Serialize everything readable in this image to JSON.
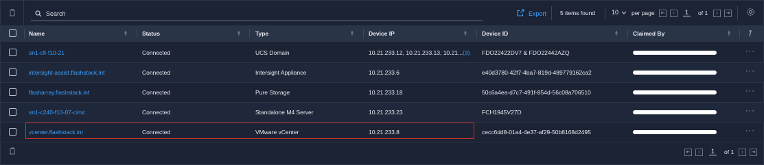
{
  "toolbar": {
    "search_label": "Search",
    "export_label": "Export",
    "items_found": "5 items found",
    "per_page_value": "10",
    "per_page_label": "per page",
    "page_current": "1",
    "page_of": "of 1"
  },
  "table": {
    "columns": [
      "Name",
      "Status",
      "Type",
      "Device IP",
      "Device ID",
      "Claimed By"
    ],
    "rows": [
      {
        "name": "sn1-cfi-f10-21",
        "status": "Connected",
        "type": "UCS Domain",
        "ip": "10.21.233.12, 10.21.233.13, 10.21...",
        "ip_more": "(3)",
        "device_id": "FDO22422DV7 & FDO22442AZQ"
      },
      {
        "name": "intersight-assist.flashstack.int",
        "status": "Connected",
        "type": "Intersight Appliance",
        "ip": "10.21.233.6",
        "ip_more": "",
        "device_id": "e40d3780-42f7-4ba7-819d-489779162ca2"
      },
      {
        "name": "flasharray.flashstack.int",
        "status": "Connected",
        "type": "Pure Storage",
        "ip": "10.21.233.18",
        "ip_more": "",
        "device_id": "50c6a4ea-d7c7-491f-854d-56c08a706510"
      },
      {
        "name": "sn1-c240-f10-07-cimc",
        "status": "Connected",
        "type": "Standalone M4 Server",
        "ip": "10.21.233.23",
        "ip_more": "",
        "device_id": "FCH1945V27D"
      },
      {
        "name": "vcenter.flashstack.int",
        "status": "Connected",
        "type": "VMware vCenter",
        "ip": "10.21.233.8",
        "ip_more": "",
        "device_id": "cecc6dd8-01a4-4e37-af29-50b8168d2495"
      }
    ]
  },
  "footer": {
    "page_current": "1",
    "page_of": "of 1"
  },
  "colors": {
    "background": "#1b2334",
    "header": "#2a3447",
    "link": "#3aa0ff",
    "highlight": "#d0312d"
  },
  "icons": [
    "trash-icon",
    "search-icon",
    "export-icon",
    "chevron-down-icon",
    "first-page-icon",
    "prev-page-icon",
    "next-page-icon",
    "last-page-icon",
    "gear-icon",
    "pin-icon",
    "more-icon"
  ]
}
